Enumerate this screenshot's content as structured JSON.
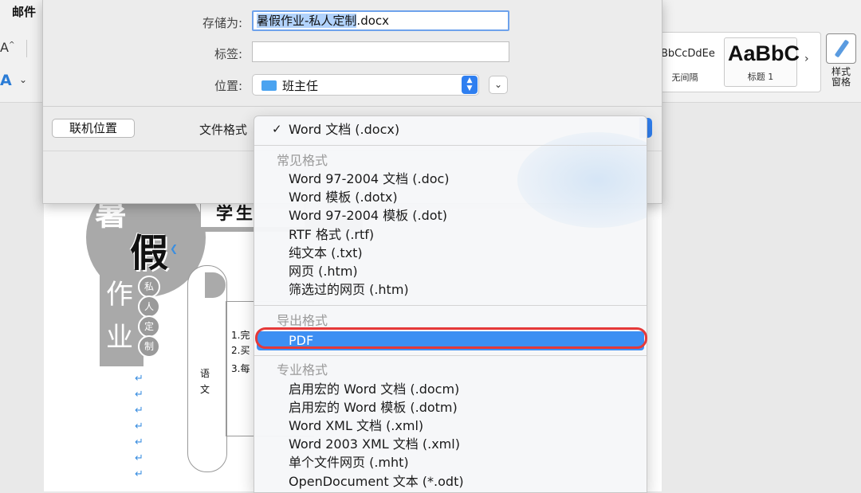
{
  "ribbon": {
    "mail_tab": "邮件",
    "font_grow": "A",
    "font_color": "A",
    "styles": [
      {
        "sample": "BbCcDdEe",
        "caption": "无间隔"
      },
      {
        "sample": "AaBbC",
        "caption": "标题 1"
      }
    ],
    "more_styles": "›",
    "styles_pane_label": "样式窗格"
  },
  "save_dialog": {
    "save_as_label": "存储为:",
    "filename_selected": "暑假作业-私人定制",
    "filename_ext": ".docx",
    "tags_label": "标签:",
    "tags_value": "",
    "location_label": "位置:",
    "location_value": "班主任",
    "online_locations_button": "联机位置",
    "file_format_label": "文件格式"
  },
  "format_menu": {
    "current": "Word 文档 (.docx)",
    "check": "✓",
    "groups": [
      {
        "header": "常见格式",
        "items": [
          "Word 97-2004 文档 (.doc)",
          "Word 模板 (.dotx)",
          "Word 97-2004 模板 (.dot)",
          "RTF 格式 (.rtf)",
          "纯文本 (.txt)",
          "网页 (.htm)",
          "筛选过的网页 (.htm)"
        ]
      },
      {
        "header": "导出格式",
        "items": [
          "PDF"
        ]
      },
      {
        "header": "专业格式",
        "items": [
          "启用宏的 Word 文档 (.docm)",
          "启用宏的 Word 模板 (.dotm)",
          "Word XML 文档 (.xml)",
          "Word 2003 XML 文档 (.xml)",
          "单个文件网页 (.mht)",
          "OpenDocument 文本 (*.odt)"
        ]
      }
    ],
    "highlighted_item": "PDF"
  },
  "document": {
    "title_chars": [
      "暑",
      "假",
      "作",
      "业"
    ],
    "badges": [
      "私",
      "人",
      "定",
      "制"
    ],
    "student_label": "学生",
    "subject_chars": [
      "语",
      "文"
    ],
    "lines": [
      "1.完",
      "2.买",
      "3.每"
    ],
    "para_mark": "↵"
  },
  "colors": {
    "accent": "#3d8ff3",
    "highlight_ring": "#e53939",
    "selection": "#b2d3fc"
  }
}
